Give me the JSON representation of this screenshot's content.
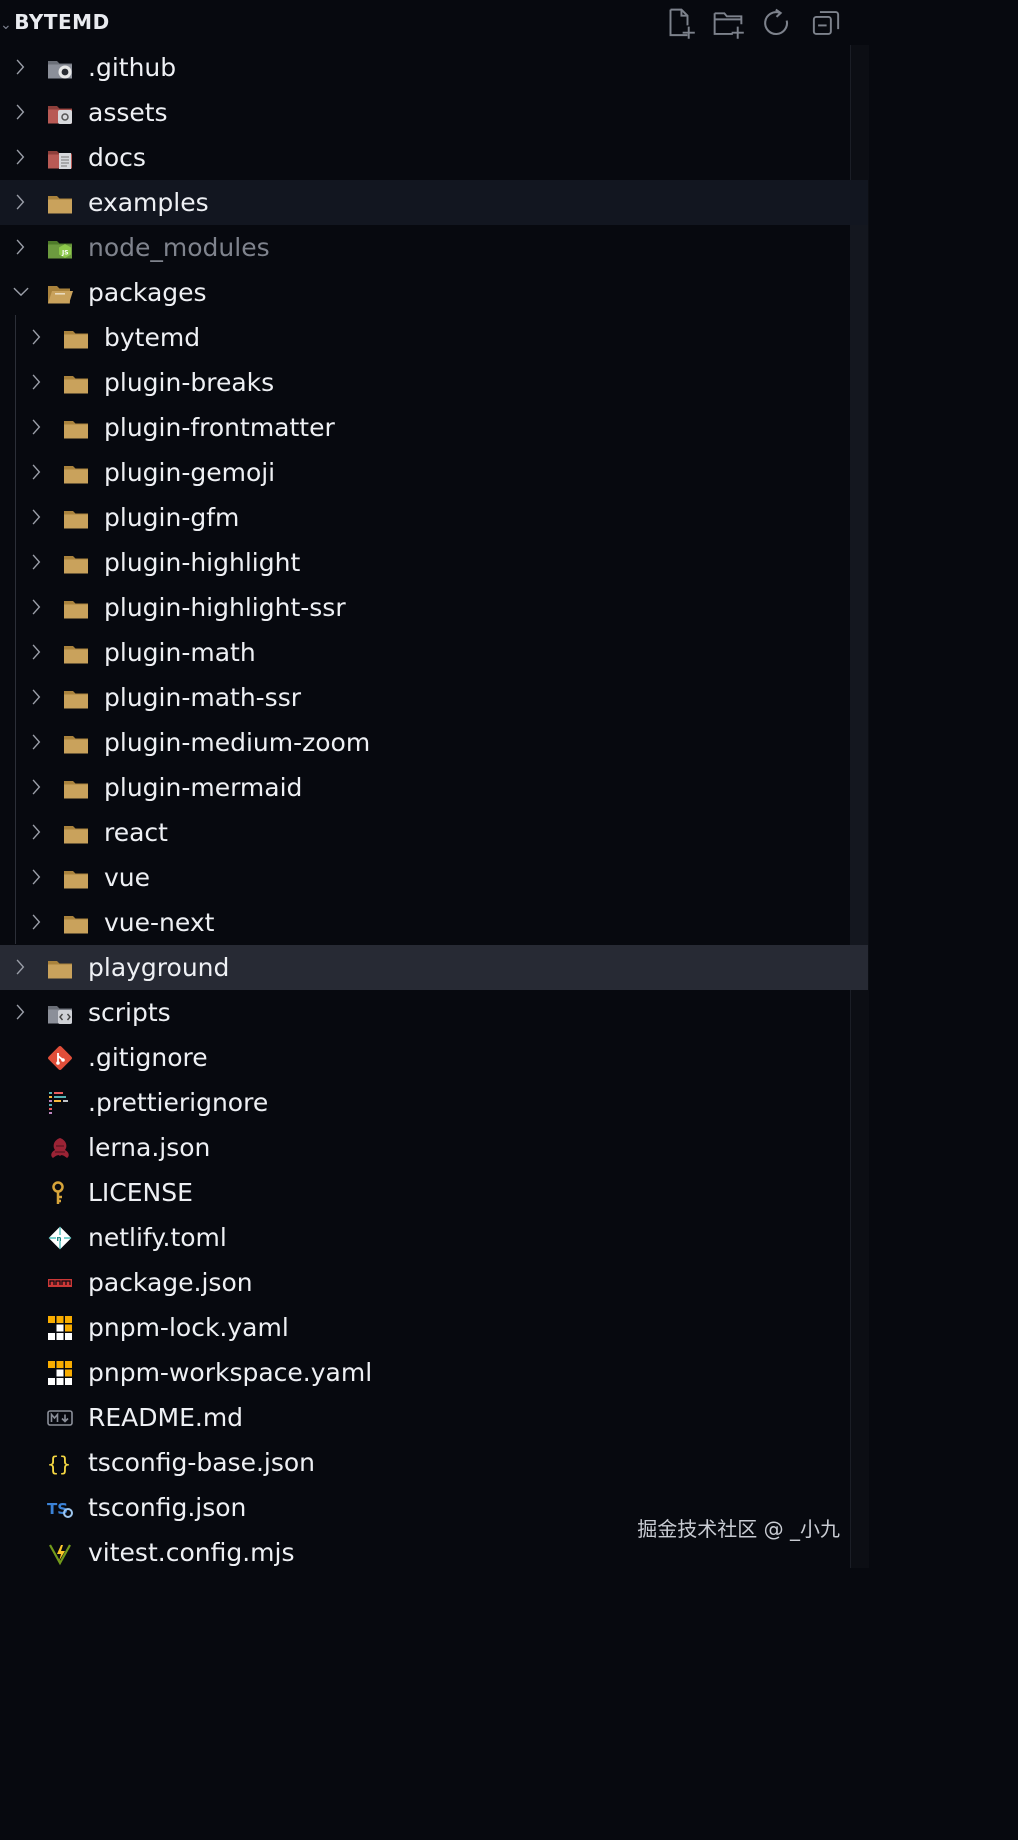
{
  "explorer": {
    "title": "BYTEMD",
    "actions": [
      {
        "name": "new-file",
        "icon": "new-file-icon"
      },
      {
        "name": "new-folder",
        "icon": "new-folder-icon"
      },
      {
        "name": "refresh",
        "icon": "refresh-icon"
      },
      {
        "name": "collapse-all",
        "icon": "collapse-all-icon"
      }
    ]
  },
  "tree": [
    {
      "label": ".github",
      "type": "folder",
      "icon": "github-folder-icon",
      "depth": 0,
      "expanded": false
    },
    {
      "label": "assets",
      "type": "folder",
      "icon": "assets-folder-icon",
      "depth": 0,
      "expanded": false
    },
    {
      "label": "docs",
      "type": "folder",
      "icon": "docs-folder-icon",
      "depth": 0,
      "expanded": false
    },
    {
      "label": "examples",
      "type": "folder",
      "icon": "folder-icon",
      "depth": 0,
      "expanded": false,
      "highlight": "hover"
    },
    {
      "label": "node_modules",
      "type": "folder",
      "icon": "node-folder-icon",
      "depth": 0,
      "expanded": false,
      "dim": true
    },
    {
      "label": "packages",
      "type": "folder",
      "icon": "folder-open-icon",
      "depth": 0,
      "expanded": true
    },
    {
      "label": "bytemd",
      "type": "folder",
      "icon": "folder-icon",
      "depth": 1,
      "expanded": false
    },
    {
      "label": "plugin-breaks",
      "type": "folder",
      "icon": "folder-icon",
      "depth": 1,
      "expanded": false
    },
    {
      "label": "plugin-frontmatter",
      "type": "folder",
      "icon": "folder-icon",
      "depth": 1,
      "expanded": false
    },
    {
      "label": "plugin-gemoji",
      "type": "folder",
      "icon": "folder-icon",
      "depth": 1,
      "expanded": false
    },
    {
      "label": "plugin-gfm",
      "type": "folder",
      "icon": "folder-icon",
      "depth": 1,
      "expanded": false
    },
    {
      "label": "plugin-highlight",
      "type": "folder",
      "icon": "folder-icon",
      "depth": 1,
      "expanded": false
    },
    {
      "label": "plugin-highlight-ssr",
      "type": "folder",
      "icon": "folder-icon",
      "depth": 1,
      "expanded": false
    },
    {
      "label": "plugin-math",
      "type": "folder",
      "icon": "folder-icon",
      "depth": 1,
      "expanded": false
    },
    {
      "label": "plugin-math-ssr",
      "type": "folder",
      "icon": "folder-icon",
      "depth": 1,
      "expanded": false
    },
    {
      "label": "plugin-medium-zoom",
      "type": "folder",
      "icon": "folder-icon",
      "depth": 1,
      "expanded": false
    },
    {
      "label": "plugin-mermaid",
      "type": "folder",
      "icon": "folder-icon",
      "depth": 1,
      "expanded": false
    },
    {
      "label": "react",
      "type": "folder",
      "icon": "folder-icon",
      "depth": 1,
      "expanded": false
    },
    {
      "label": "vue",
      "type": "folder",
      "icon": "folder-icon",
      "depth": 1,
      "expanded": false
    },
    {
      "label": "vue-next",
      "type": "folder",
      "icon": "folder-icon",
      "depth": 1,
      "expanded": false
    },
    {
      "label": "playground",
      "type": "folder",
      "icon": "folder-icon",
      "depth": 0,
      "expanded": false,
      "highlight": "selected"
    },
    {
      "label": "scripts",
      "type": "folder",
      "icon": "scripts-folder-icon",
      "depth": 0,
      "expanded": false
    },
    {
      "label": ".gitignore",
      "type": "file",
      "icon": "git-icon",
      "depth": 0
    },
    {
      "label": ".prettierignore",
      "type": "file",
      "icon": "prettier-icon",
      "depth": 0
    },
    {
      "label": "lerna.json",
      "type": "file",
      "icon": "lerna-icon",
      "depth": 0
    },
    {
      "label": "LICENSE",
      "type": "file",
      "icon": "license-icon",
      "depth": 0
    },
    {
      "label": "netlify.toml",
      "type": "file",
      "icon": "netlify-icon",
      "depth": 0
    },
    {
      "label": "package.json",
      "type": "file",
      "icon": "npm-icon",
      "depth": 0
    },
    {
      "label": "pnpm-lock.yaml",
      "type": "file",
      "icon": "pnpm-icon",
      "depth": 0
    },
    {
      "label": "pnpm-workspace.yaml",
      "type": "file",
      "icon": "pnpm-icon",
      "depth": 0
    },
    {
      "label": "README.md",
      "type": "file",
      "icon": "markdown-icon",
      "depth": 0
    },
    {
      "label": "tsconfig-base.json",
      "type": "file",
      "icon": "json-braces-icon",
      "depth": 0
    },
    {
      "label": "tsconfig.json",
      "type": "file",
      "icon": "tsconfig-icon",
      "depth": 0
    },
    {
      "label": "vitest.config.mjs",
      "type": "file",
      "icon": "vitest-icon",
      "depth": 0
    }
  ],
  "watermark": "掘金技术社区 @ _小九",
  "colors": {
    "background": "#07090f",
    "hover_row": "#121620",
    "selected_row": "#272a34",
    "folder": "#c9a25c",
    "text": "#eef0f4",
    "dim_text": "#7f838d"
  }
}
